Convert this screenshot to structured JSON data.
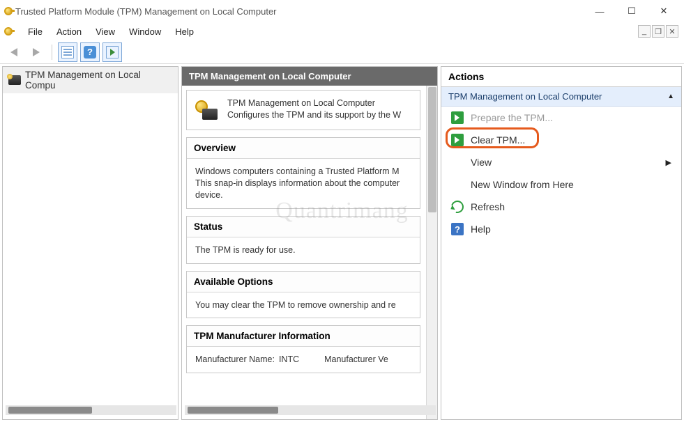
{
  "window": {
    "title": "Trusted Platform Module (TPM) Management on Local Computer"
  },
  "menubar": {
    "items": [
      "File",
      "Action",
      "View",
      "Window",
      "Help"
    ]
  },
  "tree": {
    "root": "TPM Management on Local Compu"
  },
  "center": {
    "header": "TPM Management on Local Computer",
    "intro_line1": "TPM Management on Local Computer",
    "intro_line2": "Configures the TPM and its support by the W",
    "sections": {
      "overview": {
        "title": "Overview",
        "body": "Windows computers containing a Trusted Platform M\nThis snap-in displays information about the computer\ndevice."
      },
      "status": {
        "title": "Status",
        "body": "The TPM is ready for use."
      },
      "options": {
        "title": "Available Options",
        "body": "You may clear the TPM to remove ownership and re"
      },
      "manufacturer": {
        "title": "TPM Manufacturer Information",
        "name_label": "Manufacturer Name:",
        "name_value": "INTC",
        "version_label": "Manufacturer Ve"
      }
    }
  },
  "actions": {
    "header": "Actions",
    "group": "TPM Management on Local Computer",
    "items": {
      "prepare": "Prepare the TPM...",
      "clear": "Clear TPM...",
      "view": "View",
      "newwin": "New Window from Here",
      "refresh": "Refresh",
      "help": "Help"
    }
  },
  "watermark": "Quantrimang"
}
